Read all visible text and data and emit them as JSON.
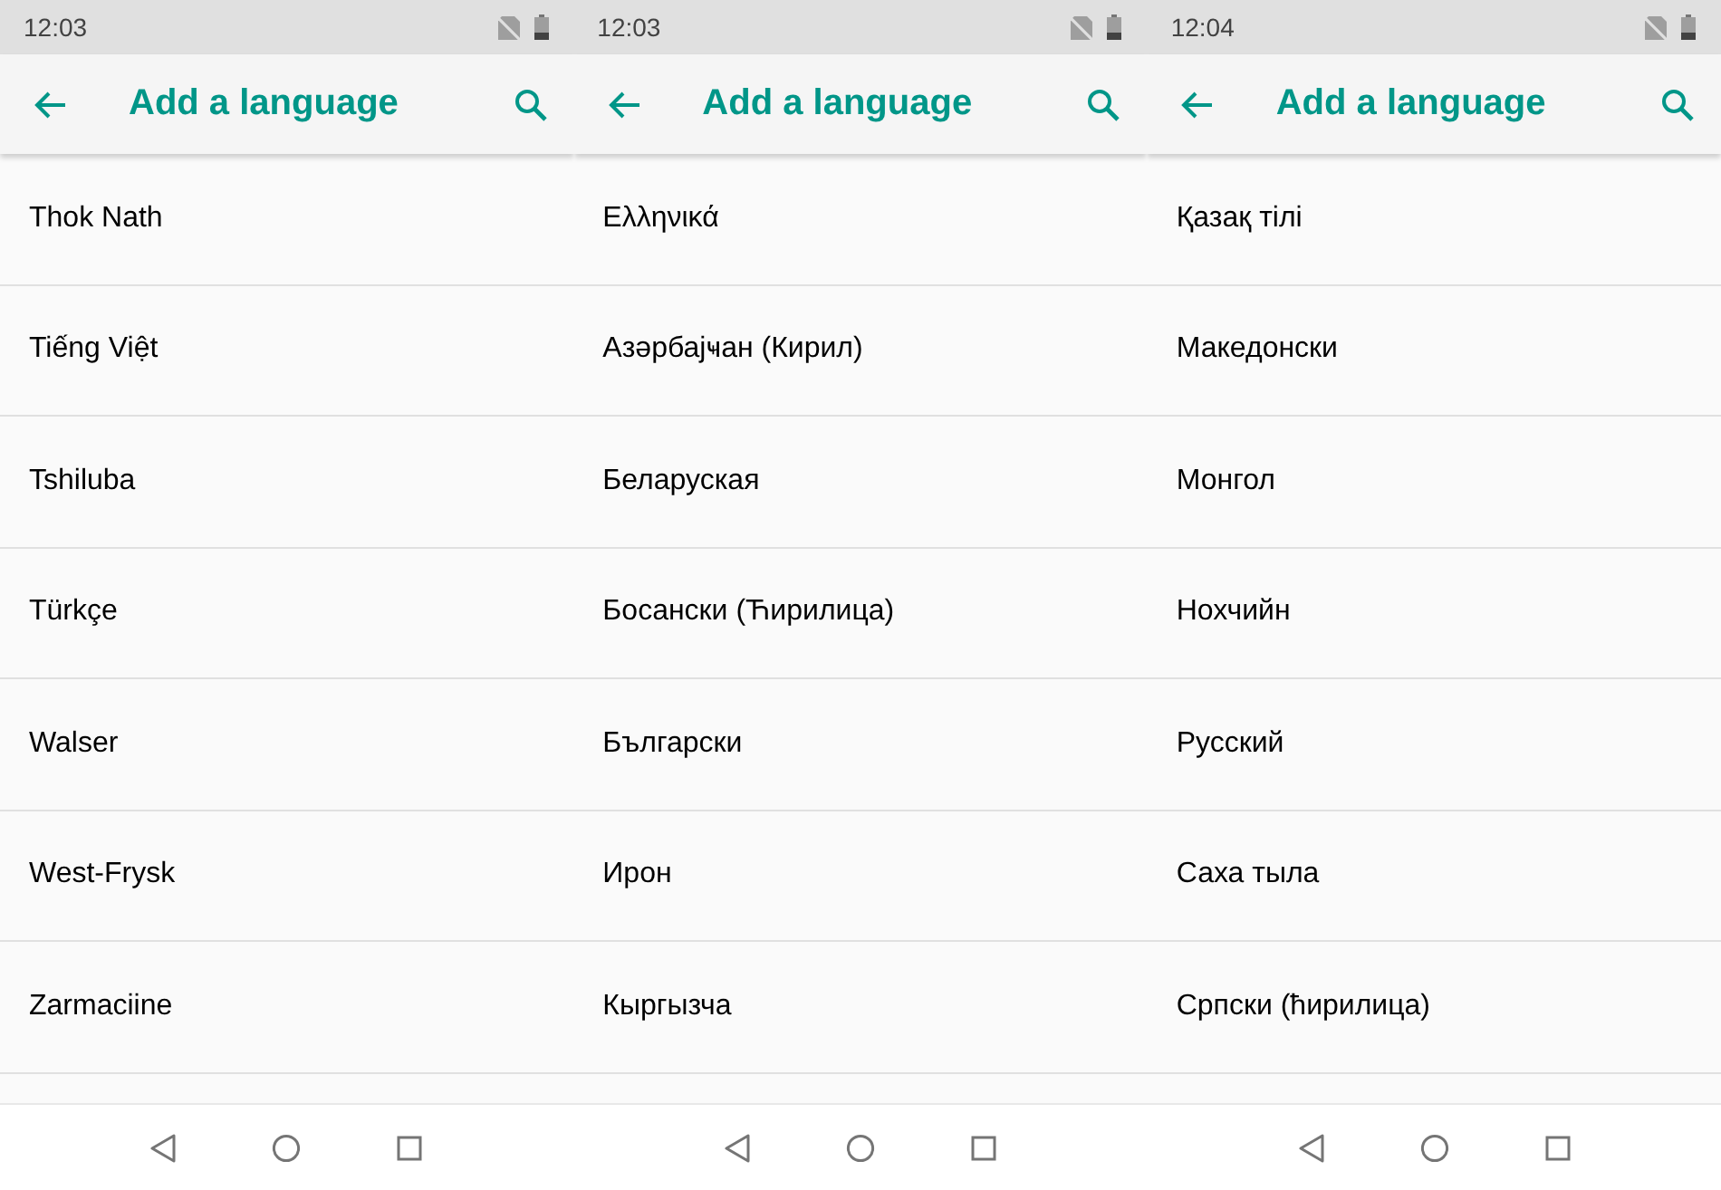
{
  "screens": [
    {
      "status_bar": {
        "time": "12:03"
      },
      "app_bar": {
        "title": "Add a language"
      },
      "languages": [
        "Thok Nath",
        "Tiếng Việt",
        "Tshiluba",
        "Türkçe",
        "Walser",
        "West-Frysk",
        "Zarmaciine"
      ]
    },
    {
      "status_bar": {
        "time": "12:03"
      },
      "app_bar": {
        "title": "Add a language"
      },
      "languages": [
        "Ελληνικά",
        "Азәрбајҹан (Кирил)",
        "Беларуская",
        "Босански (Ћирилица)",
        "Български",
        "Ирон",
        "Кыргызча"
      ]
    },
    {
      "status_bar": {
        "time": "12:04"
      },
      "app_bar": {
        "title": "Add a language"
      },
      "languages": [
        "Қазақ тілі",
        "Македонски",
        "Монгол",
        "Нохчийн",
        "Русский",
        "Саха тыла",
        "Српски (ћирилица)"
      ]
    }
  ]
}
